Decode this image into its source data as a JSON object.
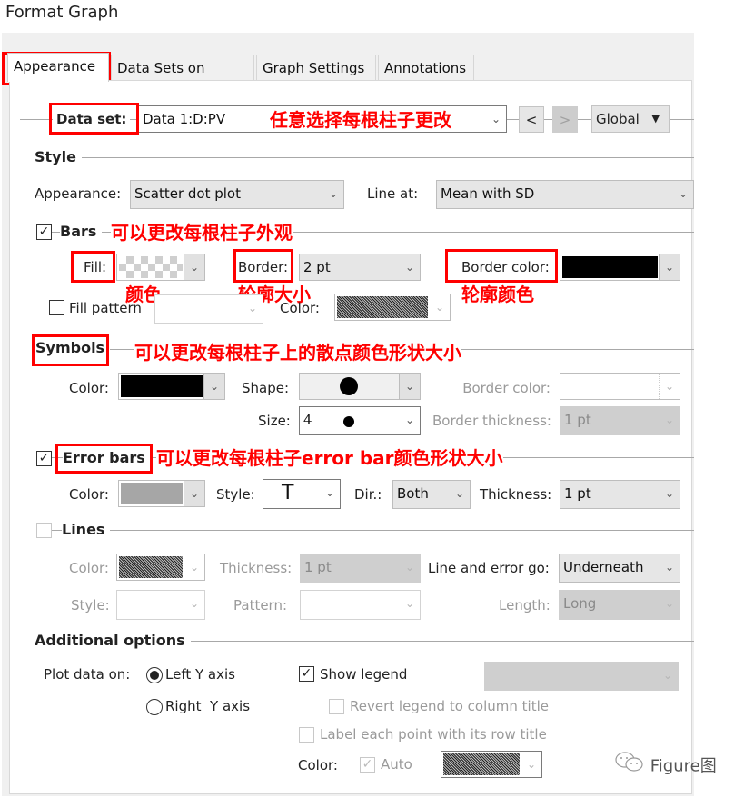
{
  "window": {
    "title": "Format Graph"
  },
  "tabs": [
    {
      "label": "Appearance",
      "active": true
    },
    {
      "label": "Data Sets on Graph",
      "active": false
    },
    {
      "label": "Graph Settings",
      "active": false
    },
    {
      "label": "Annotations",
      "active": false
    }
  ],
  "dataset": {
    "label": "Data set:",
    "value": "Data 1:D:PV",
    "prev_button": "<",
    "next_button": ">",
    "scope": "Global",
    "scope_arrow": "▼"
  },
  "style": {
    "heading": "Style",
    "appearance_label": "Appearance:",
    "appearance_value": "Scatter dot plot",
    "line_at_label": "Line at:",
    "line_at_value": "Mean with SD"
  },
  "bars": {
    "heading": "Bars",
    "checked": true,
    "fill_label": "Fill:",
    "border_label": "Border:",
    "border_value": "2 pt",
    "border_color_label": "Border color:",
    "border_color": "#000000",
    "fill_pattern_label": "Fill pattern",
    "fill_pattern_checked": false,
    "pattern_color_label": "Color:"
  },
  "symbols": {
    "heading": "Symbols",
    "color_label": "Color:",
    "color": "#000000",
    "shape_label": "Shape:",
    "shape_value": "●",
    "size_label": "Size:",
    "size_value": "4",
    "size_preview": "●",
    "border_color_label": "Border color:",
    "border_thickness_label": "Border thickness:",
    "border_thickness_value": "1 pt"
  },
  "error_bars": {
    "heading": "Error bars",
    "checked": true,
    "color_label": "Color:",
    "color": "#a6a6a6",
    "style_label": "Style:",
    "style_value": "T",
    "dir_label": "Dir.:",
    "dir_value": "Both",
    "thickness_label": "Thickness:",
    "thickness_value": "1 pt"
  },
  "lines": {
    "heading": "Lines",
    "checked": false,
    "color_label": "Color:",
    "thickness_label": "Thickness:",
    "thickness_value": "1 pt",
    "line_error_label": "Line and error go:",
    "line_error_value": "Underneath",
    "style_label": "Style:",
    "pattern_label": "Pattern:",
    "length_label": "Length:",
    "length_value": "Long"
  },
  "additional": {
    "heading": "Additional options",
    "plot_on_label": "Plot data on:",
    "left_axis": "Left Y axis",
    "right_axis": "Right  Y axis",
    "plot_on_selected": "left",
    "show_legend": "Show legend",
    "show_legend_checked": true,
    "revert_legend": "Revert legend to column title",
    "label_points": "Label each point with its row title",
    "color_label": "Color:",
    "auto_label": "Auto",
    "auto_checked": true
  },
  "annotations": {
    "dataset_note": "任意选择每根柱子更改",
    "bars_note": "可以更改每根柱子外观",
    "fill_note": "颜色",
    "border_note": "轮廓大小",
    "border_color_note": "轮廓颜色",
    "symbols_note": "可以更改每根柱子上的散点颜色形状大小",
    "error_bars_note": "可以更改每根柱子error bar颜色形状大小",
    "highlight_color": "#ff0000"
  },
  "watermark": {
    "icon": "wechat-icon",
    "text": "Figure图"
  },
  "glyphs": {
    "chevron": "⌄",
    "check": "✓"
  }
}
